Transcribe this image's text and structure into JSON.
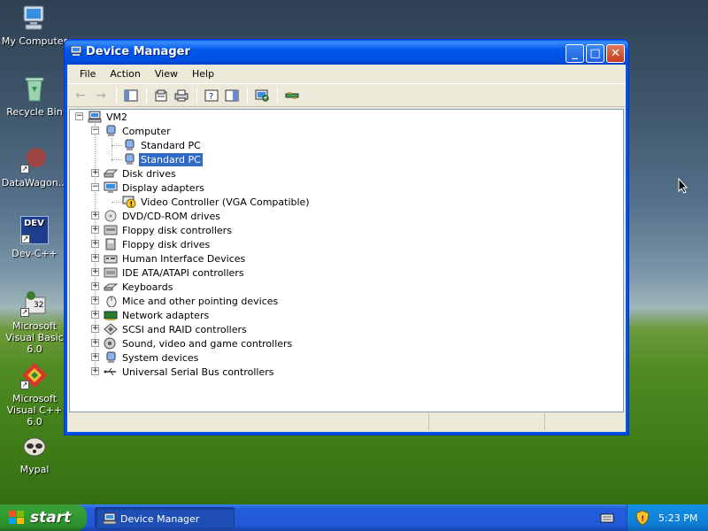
{
  "desktop": {
    "icons": [
      {
        "label": "My Computer"
      },
      {
        "label": "Recycle Bin"
      },
      {
        "label": "DataWagon..."
      },
      {
        "label": "Dev-C++"
      },
      {
        "label": "Microsoft Visual Basic 6.0"
      },
      {
        "label": "Microsoft Visual C++ 6.0"
      },
      {
        "label": "Mypal"
      }
    ],
    "dev_badge": "DEV",
    "vb_badge": "32"
  },
  "window": {
    "title": "Device Manager",
    "menu": [
      "File",
      "Action",
      "View",
      "Help"
    ],
    "tree": {
      "root": "VM2",
      "computer": "Computer",
      "computer_children": [
        "Standard PC",
        "Standard PC"
      ],
      "disk_drives": "Disk drives",
      "display_adapters": "Display adapters",
      "display_children": [
        "Video Controller (VGA Compatible)"
      ],
      "others": [
        "DVD/CD-ROM drives",
        "Floppy disk controllers",
        "Floppy disk drives",
        "Human Interface Devices",
        "IDE ATA/ATAPI controllers",
        "Keyboards",
        "Mice and other pointing devices",
        "Network adapters",
        "SCSI and RAID controllers",
        "Sound, video and game controllers",
        "System devices",
        "Universal Serial Bus controllers"
      ]
    },
    "expand_symbol": "+",
    "collapse_symbol": "−"
  },
  "taskbar": {
    "start_label": "start",
    "task_label": "Device Manager",
    "clock": "5:23 PM"
  },
  "colors": {
    "selection": "#316ac5",
    "titlebar": "#0058ee",
    "taskbar": "#245edb",
    "start": "#35a035"
  }
}
